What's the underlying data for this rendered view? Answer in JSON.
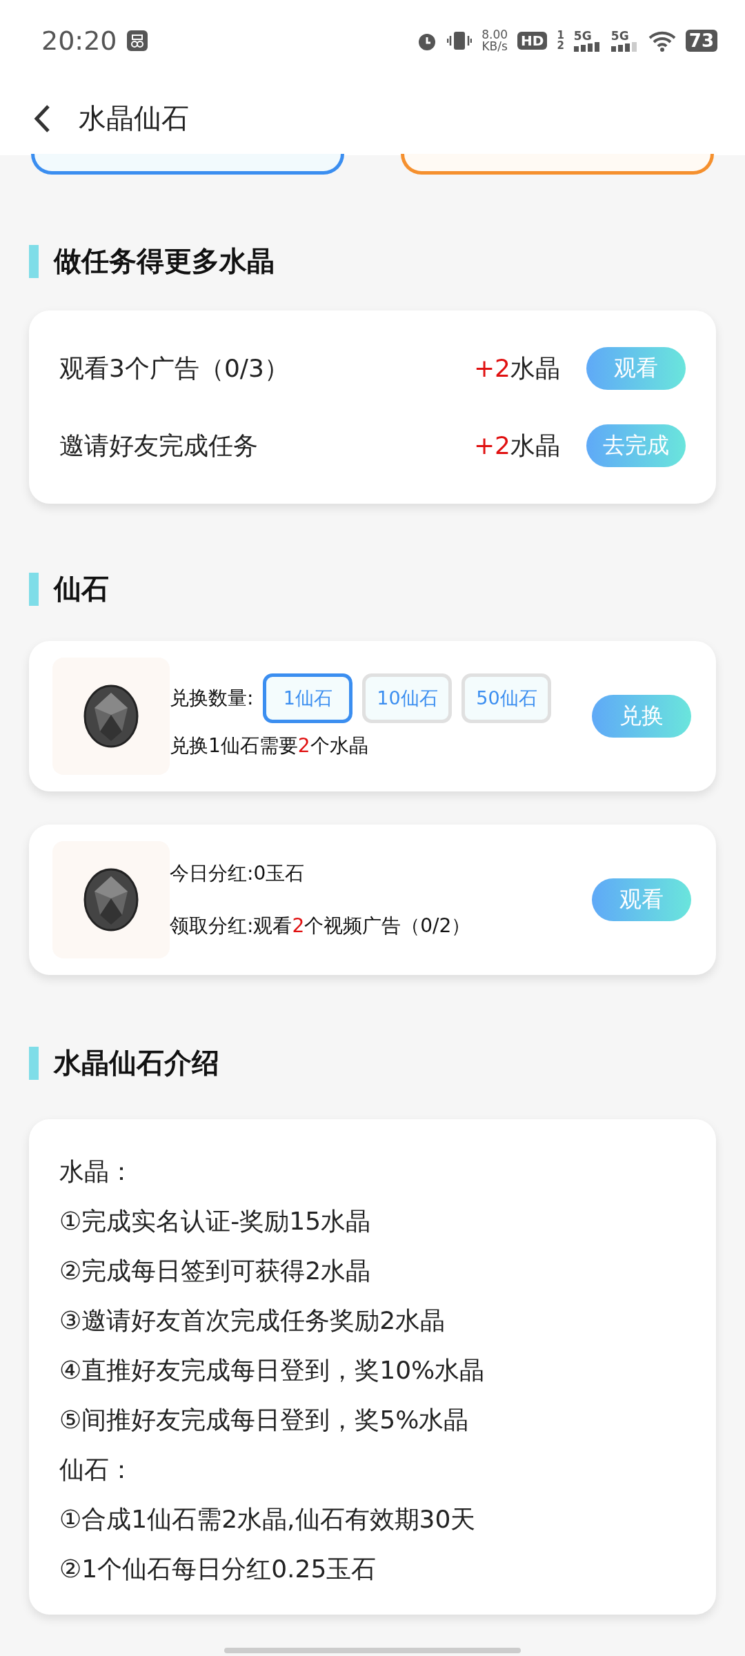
{
  "status_bar": {
    "time": "20:20",
    "speed": "8.00",
    "speed_unit": "KB/s",
    "hd": "HD",
    "sim_slots": [
      "1",
      "2"
    ],
    "networks": [
      "5G",
      "5G"
    ],
    "battery": "73"
  },
  "header": {
    "title": "水晶仙石"
  },
  "top_cards": [
    {
      "color": "#3b8ef0"
    },
    {
      "color": "#f5902e"
    }
  ],
  "tasks_section": {
    "title": "做任务得更多水晶",
    "tasks": [
      {
        "label": "观看3个广告（0/3）",
        "amount": "+2",
        "unit": "水晶",
        "button": "观看"
      },
      {
        "label": "邀请好友完成任务",
        "amount": "+2",
        "unit": "水晶",
        "button": "去完成"
      }
    ]
  },
  "stone_section": {
    "title": "仙石",
    "exchange": {
      "label": "兑换数量:",
      "options": [
        {
          "label": "1仙石",
          "selected": true
        },
        {
          "label": "10仙石",
          "selected": false
        },
        {
          "label": "50仙石",
          "selected": false
        }
      ],
      "note": [
        "兑换1仙石需要",
        "2",
        "个水晶"
      ],
      "button": "兑换"
    },
    "dividend": {
      "today": "今日分红:0玉石",
      "claim": [
        "领取分红:观看",
        "2",
        "个视频广告（0/2）"
      ],
      "button": "观看"
    }
  },
  "intro_section": {
    "title": "水晶仙石介绍",
    "lines": [
      "水晶：",
      "①完成实名认证-奖励15水晶",
      "②完成每日签到可获得2水晶",
      "③邀请好友首次完成任务奖励2水晶",
      "④直推好友完成每日登到，奖10%水晶",
      "⑤间推好友完成每日登到，奖5%水晶",
      "仙石：",
      "①合成1仙石需2水晶,仙石有效期30天",
      "②1个仙石每日分红0.25玉石"
    ]
  }
}
